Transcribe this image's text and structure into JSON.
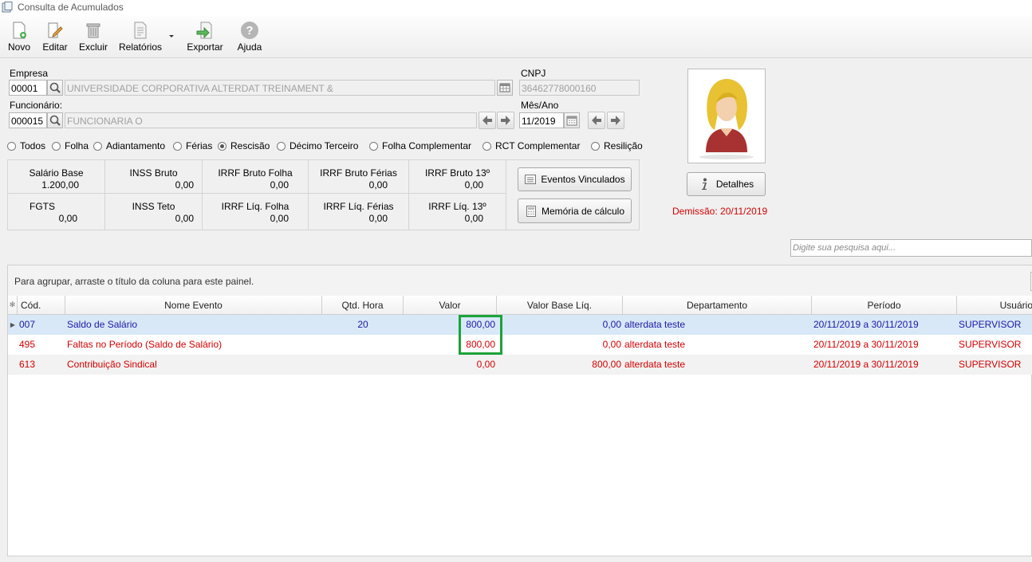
{
  "window": {
    "title": "Consulta de Acumulados"
  },
  "toolbar": {
    "novo": "Novo",
    "editar": "Editar",
    "excluir": "Excluir",
    "relatorios": "Relatórios",
    "exportar": "Exportar",
    "ajuda": "Ajuda"
  },
  "form": {
    "empresa_label": "Empresa",
    "empresa_code": "00001",
    "empresa_name": "UNIVERSIDADE CORPORATIVA ALTERDAT TREINAMENT &",
    "cnpj_label": "CNPJ",
    "cnpj_value": "36462778000160",
    "funcionario_label": "Funcionário:",
    "funcionario_code": "000015",
    "funcionario_name": "FUNCIONARIA O",
    "mesano_label": "Mês/Ano",
    "mesano_value": "11/2019"
  },
  "filters": [
    {
      "label": "Todos",
      "selected": false
    },
    {
      "label": "Folha",
      "selected": false
    },
    {
      "label": "Adiantamento",
      "selected": false
    },
    {
      "label": "Férias",
      "selected": false
    },
    {
      "label": "Rescisão",
      "selected": true
    },
    {
      "label": "Décimo Terceiro",
      "selected": false
    },
    {
      "label": "Folha Complementar",
      "selected": false
    },
    {
      "label": "RCT Complementar",
      "selected": false
    },
    {
      "label": "Resilição",
      "selected": false
    }
  ],
  "totals": {
    "salario_base": {
      "label": "Salário Base",
      "value": "1.200,00"
    },
    "inss_bruto": {
      "label": "INSS Bruto",
      "value": "0,00"
    },
    "irrf_bruto_folha": {
      "label": "IRRF Bruto Folha",
      "value": "0,00"
    },
    "irrf_bruto_ferias": {
      "label": "IRRF Bruto Férias",
      "value": "0,00"
    },
    "irrf_bruto_13": {
      "label": "IRRF Bruto 13º",
      "value": "0,00"
    },
    "fgts": {
      "label": "FGTS",
      "value": "0,00"
    },
    "inss_teto": {
      "label": "INSS Teto",
      "value": "0,00"
    },
    "irrf_liq_folha": {
      "label": "IRRF Líq. Folha",
      "value": "0,00"
    },
    "irrf_liq_ferias": {
      "label": "IRRF Líq. Férias",
      "value": "0,00"
    },
    "irrf_liq_13": {
      "label": "IRRF Líq. 13º",
      "value": "0,00"
    }
  },
  "actions": {
    "eventos_vinculados": "Eventos Vinculados",
    "memoria_calculo": "Memória de cálculo",
    "detalhes": "Detalhes",
    "demissao": "Demissão: 20/11/2019"
  },
  "search": {
    "placeholder": "Digite sua pesquisa aqui..."
  },
  "grid": {
    "group_hint": "Para agrupar, arraste o título da coluna para este painel.",
    "columns": [
      "Cód.",
      "Nome Evento",
      "Qtd. Hora",
      "Valor",
      "Valor Base Líq.",
      "Departamento",
      "Período",
      "Usuário"
    ],
    "rows": [
      {
        "cod": "007",
        "nome": "Saldo de Salário",
        "qtd": "20",
        "valor": "800,00",
        "base": "0,00",
        "dep": "alterdata teste",
        "periodo": "20/11/2019 a 30/11/2019",
        "usuario": "SUPERVISOR",
        "color": "#1a1aa8"
      },
      {
        "cod": "495",
        "nome": "Faltas no Período (Saldo de Salário)",
        "qtd": "",
        "valor": "800,00",
        "base": "0,00",
        "dep": "alterdata teste",
        "periodo": "20/11/2019 a 30/11/2019",
        "usuario": "SUPERVISOR",
        "color": "#d40000"
      },
      {
        "cod": "613",
        "nome": "Contribuição Sindical",
        "qtd": "",
        "valor": "0,00",
        "base": "800,00",
        "dep": "alterdata teste",
        "periodo": "20/11/2019 a 30/11/2019",
        "usuario": "SUPERVISOR",
        "color": "#d40000"
      }
    ]
  },
  "colors": {
    "highlight": "#1aa33a",
    "selected_row": "#d9e8f7",
    "alt_row": "#f2f2f2"
  }
}
